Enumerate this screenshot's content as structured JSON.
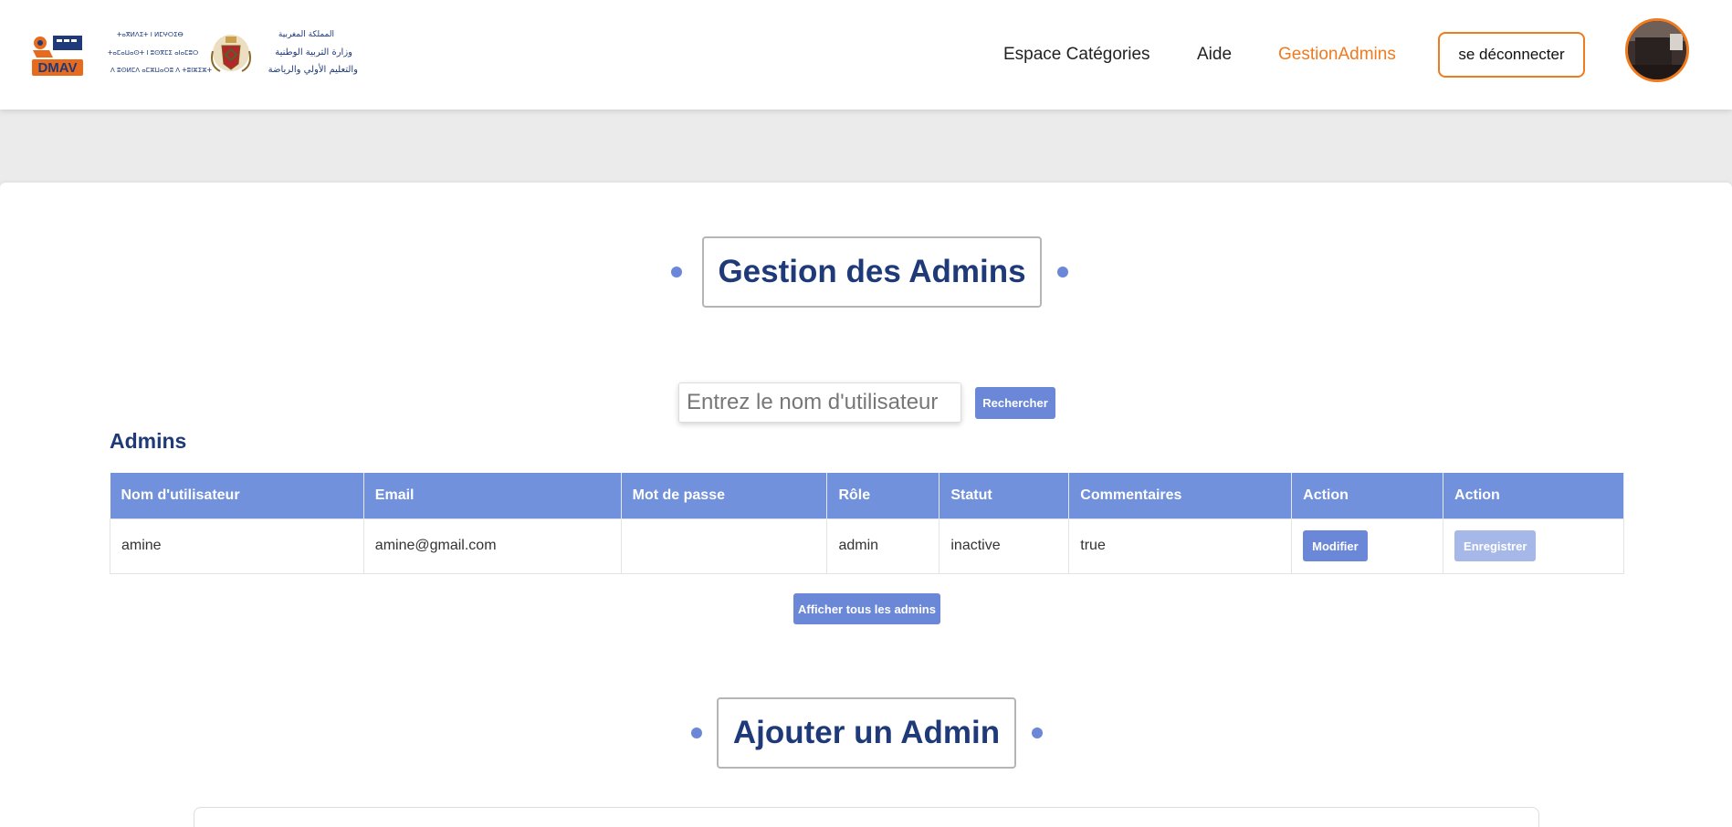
{
  "header": {
    "logo_dmav_text": "DMAV",
    "ministry_arabic_lines": [
      "المملكة المغربية",
      "وزارة التربية الوطنية",
      "والتعليم الأولي والرياضة"
    ],
    "ministry_tifinagh_lines": [
      "ⵜⴰⴳⵍⴷⵉⵜ ⵏ ⵍⵎⵖⵔⵉⴱ",
      "ⵜⴰⵎⴰⵡⴰⵙⵜ ⵏ ⵓⵙⴳⵎⵉ ⴰⵏⴰⵎⵓⵔ",
      "ⴷ ⵓⵙⵍⵎⴷ ⴰⵎⵣⵡⴰⵔⵓ ⴷ ⵜⵓⵏⵣⵉⵣⵜ"
    ],
    "nav": {
      "espace_categories": "Espace Catégories",
      "aide": "Aide",
      "gestion_admins": "GestionAdmins"
    },
    "logout_label": "se déconnecter"
  },
  "main": {
    "title": "Gestion des Admins",
    "search": {
      "placeholder": "Entrez le nom d'utilisateur",
      "value": "",
      "button_label": "Rechercher"
    },
    "admins_heading": "Admins",
    "table": {
      "columns": [
        "Nom d'utilisateur",
        "Email",
        "Mot de passe",
        "Rôle",
        "Statut",
        "Commentaires",
        "Action",
        "Action"
      ],
      "rows": [
        {
          "username": "amine",
          "email": "amine@gmail.com",
          "password": "",
          "role": "admin",
          "status": "inactive",
          "comments": "true",
          "action_modify": "Modifier",
          "action_save": "Enregistrer"
        }
      ]
    },
    "show_all_label": "Afficher tous les admins",
    "add_title": "Ajouter un Admin"
  },
  "colors": {
    "accent_orange": "#f07a1e",
    "primary_blue": "#6b87d8",
    "table_header_blue": "#7191dd",
    "title_navy": "#1f3a78"
  }
}
